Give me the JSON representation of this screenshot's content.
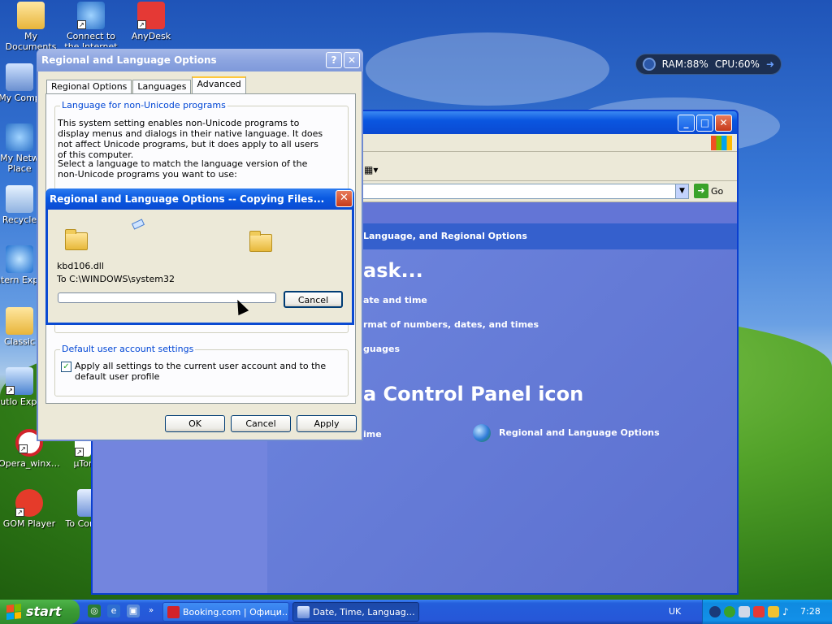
{
  "desktop": {
    "icons": [
      {
        "label": "My Documents"
      },
      {
        "label": "Connect to the Internet"
      },
      {
        "label": "AnyDesk"
      },
      {
        "label": "My Comp"
      },
      {
        "label": "My Netw Place"
      },
      {
        "label": "Recycle"
      },
      {
        "label": "Intern Explo"
      },
      {
        "label": "Classic"
      },
      {
        "label": "Outlo Expre"
      },
      {
        "label": "Opera_winx…"
      },
      {
        "label": "µTor"
      },
      {
        "label": "GOM Player"
      },
      {
        "label": "To Comm"
      }
    ]
  },
  "perf_widget": {
    "ram": "RAM:88%",
    "cpu": "CPU:60%"
  },
  "control_panel": {
    "address_go": "Go",
    "breadcrumb": "Language, and Regional Options",
    "pick_task_heading": "ask...",
    "task_1": "ate and time",
    "task_2": "rmat of numbers, dates, and times",
    "task_3": "guages",
    "pick_icon_heading": "a Control Panel icon",
    "icon_1": "ime",
    "icon_2": "Regional and Language Options"
  },
  "regional_dialog": {
    "title": "Regional and Language Options",
    "help": "?",
    "close": "✕",
    "tabs": [
      "Regional Options",
      "Languages",
      "Advanced"
    ],
    "active_tab": "Advanced",
    "group1_title": "Language for non-Unicode programs",
    "group1_text": "This system setting enables non-Unicode programs to display menus and dialogs in their native language. It does not affect Unicode programs, but it does apply to all users of this computer.",
    "group1_select_text": "Select a language to match the language version of the non-Unicode programs you want to use:",
    "group2_title": "Default user account settings",
    "checkbox_label": "Apply all settings to the current user account and to the default user profile",
    "checkbox_checked": true,
    "ok": "OK",
    "cancel": "Cancel",
    "apply": "Apply"
  },
  "copy_dialog": {
    "title": "Regional and Language Options -- Copying Files...",
    "close": "✕",
    "file": "kbd106.dll",
    "destination": "To C:\\WINDOWS\\system32",
    "progress": 0.0,
    "cancel": "Cancel"
  },
  "taskbar": {
    "start": "start",
    "tasks": [
      {
        "label": "Booking.com | Офици…"
      },
      {
        "label": "Date, Time, Languag…"
      }
    ],
    "language": "UK",
    "clock": "7:28"
  },
  "colors": {
    "xp_blue": "#0a4ad2",
    "dialog_face": "#ece9d8",
    "start_green": "#3c9d36",
    "group_title_blue": "#0046d5"
  }
}
